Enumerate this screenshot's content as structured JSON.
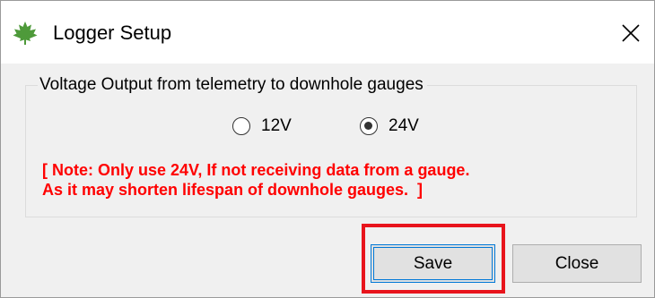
{
  "window": {
    "title": "Logger Setup",
    "icon": "maple-leaf-icon",
    "close_icon": "close-icon"
  },
  "group": {
    "legend": "Voltage Output from telemetry to downhole gauges",
    "options": [
      {
        "label": "12V",
        "checked": false
      },
      {
        "label": "24V",
        "checked": true
      }
    ],
    "note_line1": "[ Note: Only use 24V, If not receiving data from a gauge.",
    "note_line2": "As it may shorten lifespan of downhole gauges.  ]"
  },
  "buttons": {
    "save_label": "Save",
    "close_label": "Close"
  },
  "colors": {
    "note": "#ff0000",
    "highlight": "#e8141c",
    "focus": "#0078d7",
    "icon": "#4e9a3a"
  }
}
